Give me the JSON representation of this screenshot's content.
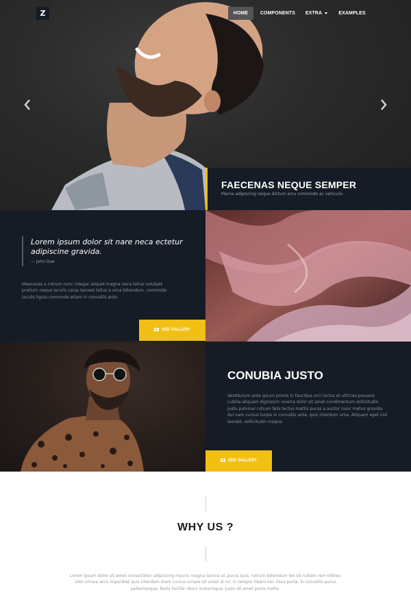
{
  "nav": {
    "logo": "Z",
    "items": [
      {
        "label": "HOME",
        "active": true
      },
      {
        "label": "COMPONENTS",
        "active": false
      },
      {
        "label": "EXTRA",
        "active": false,
        "dropdown": true
      },
      {
        "label": "EXAMPLES",
        "active": false
      }
    ]
  },
  "hero": {
    "title": "FAECENAS NEQUE SEMPER",
    "subtitle": "Marna adipiscing neque dictum arcu commodo ac vehicula",
    "prev_icon": "chevron-left-icon",
    "next_icon": "chevron-right-icon"
  },
  "section2": {
    "quote": "Lorem ipsum dolor sit nare neca ectetur adipiscine gravida.",
    "author": "— John Doe",
    "paragraph": "Maecenas a rutrum nunc integer aliquet magna neca tellus volutpat pretium neque iaculis ceras laoreet tellus a urna bibendum, commodo iaculis ligula commodo etiam in convallis ante.",
    "button": "SEE GALLERY"
  },
  "section3": {
    "title": "CONUBIA JUSTO",
    "paragraph": "Vestibulum ante ipsum primis in faucibus orci luctus et ultrices posuere cubilia aliquam dignissim viverra dolor sit amet condimentum sollicitudin justo pulvinar rutrum felis lectus mattis purus a auctor nunc metus gravida dui nam cursus turpis in convallis ante, quis interdum urna. Aliquam eget nisl laoreet, sollicitudin magna.",
    "button": "SEE GALLERY"
  },
  "why": {
    "title": "WHY US ?",
    "text": "Lorem ipsum dolor sit amet consectetur adipiscing mauris magna lacinia ac purus quis, rutrum bibendum leo sit nullam rem nibheu odio ornare arcu imperdiet quis interdum diam cursus ornare sit amet id mi. In tempor libero nec risus porta, in convallis purus pellentesque. Nulla facilisi. Nunc scelerisque, justo sit amet porta mollis."
  },
  "colors": {
    "dark_panel": "#161c26",
    "accent": "#f2c014",
    "white": "#ffffff"
  }
}
